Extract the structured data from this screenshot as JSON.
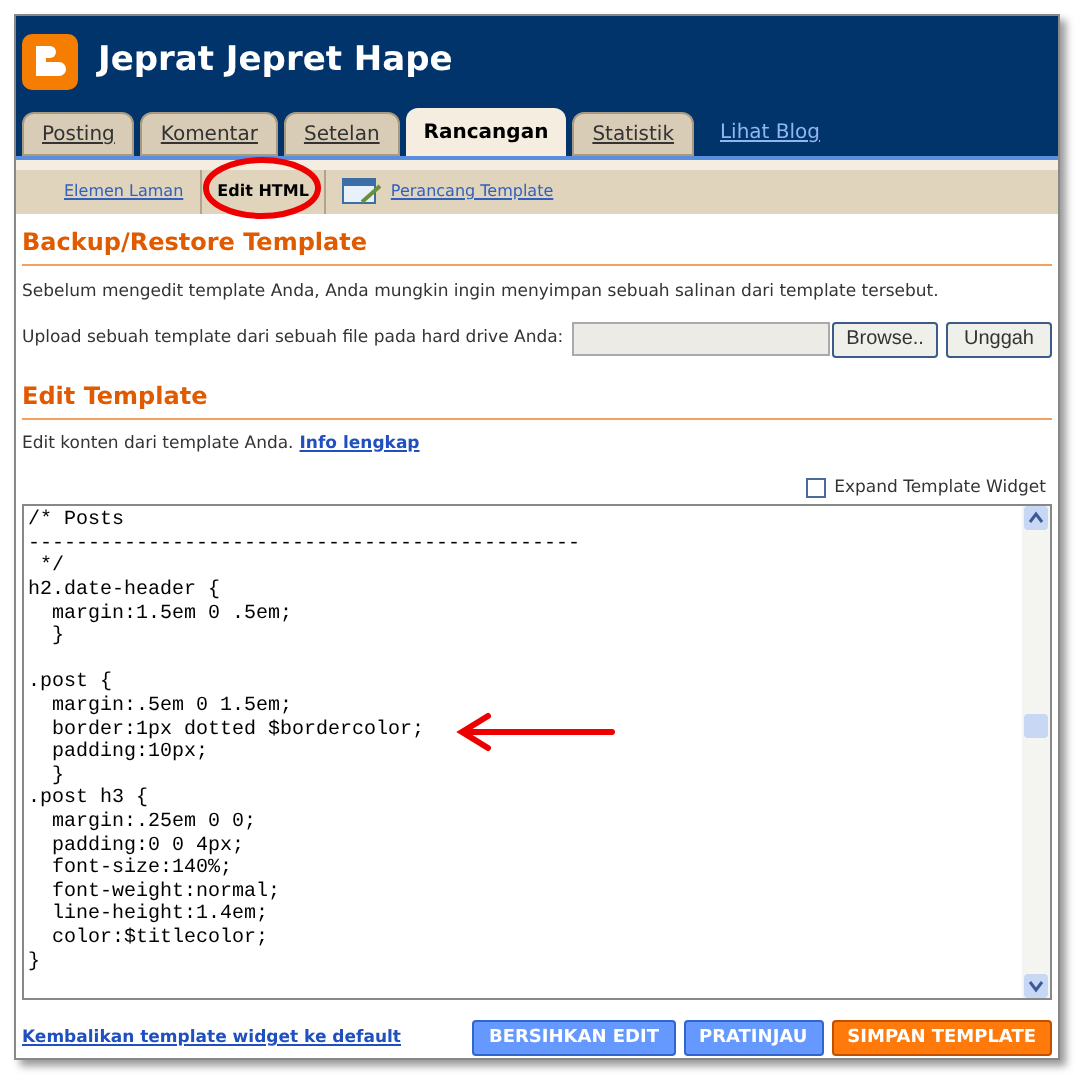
{
  "header": {
    "title": "Jeprat Jepret Hape"
  },
  "tabs": [
    {
      "label": "Posting",
      "selected": false
    },
    {
      "label": "Komentar",
      "selected": false
    },
    {
      "label": "Setelan",
      "selected": false
    },
    {
      "label": "Rancangan",
      "selected": true
    },
    {
      "label": "Statistik",
      "selected": false
    }
  ],
  "view_blog_link": "Lihat Blog",
  "subtabs": [
    {
      "label": "Elemen Laman",
      "selected": false
    },
    {
      "label": "Edit HTML",
      "selected": true
    },
    {
      "label": "Perancang Template",
      "selected": false
    }
  ],
  "backup": {
    "heading": "Backup/Restore Template",
    "description": "Sebelum mengedit template Anda, Anda mungkin ingin menyimpan sebuah salinan dari template tersebut.",
    "upload_label": "Upload sebuah template dari sebuah file pada hard drive Anda:",
    "browse_button": "Browse..",
    "upload_button": "Unggah"
  },
  "edit": {
    "heading": "Edit Template",
    "description": "Edit konten dari template Anda.",
    "info_link": "Info lengkap",
    "expand_widget": {
      "label": "Expand Template Widget",
      "checked": false
    },
    "code_blocks": [
      [
        "/* Posts",
        "----------------------------------------------",
        " */",
        "h2.date-header {",
        "  margin:1.5em 0 .5em;",
        "  }"
      ],
      [
        ".post {",
        "  margin:.5em 0 1.5em;",
        "  border:1px dotted $bordercolor;",
        "  padding:10px;",
        "  }",
        ".post h3 {",
        "  margin:.25em 0 0;",
        "  padding:0 0 4px;",
        "  font-size:140%;",
        "  font-weight:normal;",
        "  line-height:1.4em;",
        "  color:$titlecolor;",
        "}"
      ]
    ]
  },
  "footer": {
    "reset_link": "Kembalikan template widget ke default",
    "buttons": [
      {
        "label": "BERSIHKAN EDIT",
        "kind": "secondary"
      },
      {
        "label": "PRATINJAU",
        "kind": "secondary"
      },
      {
        "label": "SIMPAN TEMPLATE",
        "kind": "primary"
      }
    ]
  }
}
